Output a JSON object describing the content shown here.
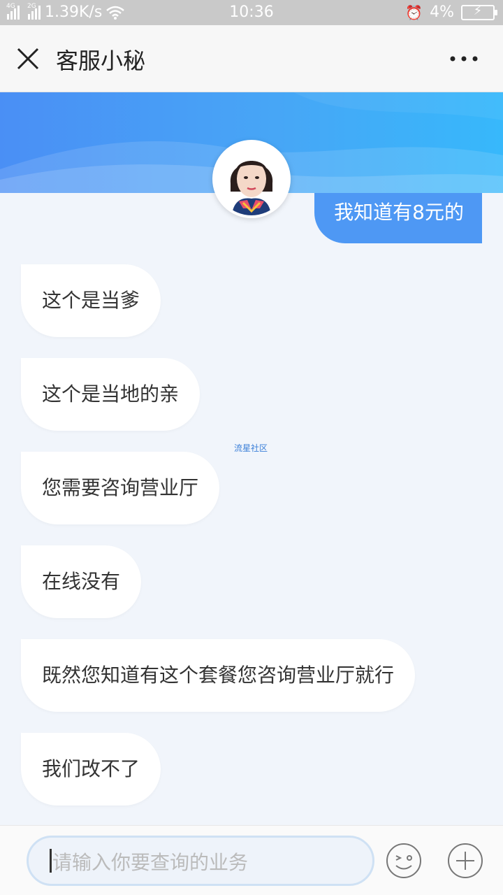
{
  "status": {
    "net1": "4G",
    "net2": "2G",
    "speed": "1.39K/s",
    "time": "10:36",
    "battery": "4%"
  },
  "header": {
    "title": "客服小秘"
  },
  "messages": {
    "user": "我知道有8元的",
    "agent": [
      "这个是当爹",
      "这个是当地的亲",
      "您需要咨询营业厅",
      "在线没有",
      "既然您知道有这个套餐您咨询营业厅就行",
      "我们改不了"
    ]
  },
  "watermark": "流星社区",
  "input": {
    "placeholder": "请输入你要查询的业务"
  },
  "icons": {
    "close": "close-icon",
    "more": "more-icon",
    "emoji": "emoji-icon",
    "plus": "plus-icon"
  },
  "colors": {
    "banner": "#4a8ff5",
    "user_bubble": "#4e98f4",
    "background": "#f1f5fb"
  }
}
